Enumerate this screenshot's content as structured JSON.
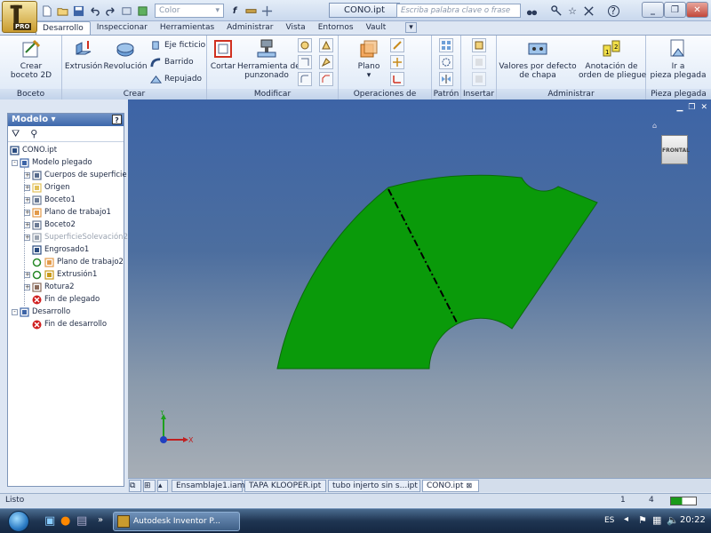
{
  "app": {
    "doc_title": "CONO.ipt",
    "search_placeholder": "Escriba palabra clave o frase",
    "badge": "PRO",
    "color_select": "Color"
  },
  "tabs": [
    "Desarrollo",
    "Inspeccionar",
    "Herramientas",
    "Administrar",
    "Vista",
    "Entornos",
    "Vault"
  ],
  "ribbon": {
    "boceto": {
      "title": "Boceto",
      "crear_boceto": "Crear\nboceto 2D"
    },
    "crear": {
      "title": "Crear",
      "extrusion": "Extrusión",
      "revolucion": "Revolución",
      "eje": "Eje ficticio",
      "barrido": "Barrido",
      "repujado": "Repujado"
    },
    "modificar": {
      "title": "Modificar",
      "cortar": "Cortar",
      "herramienta": "Herramienta de\npunzonado"
    },
    "operaciones": {
      "title": "Operaciones de trabajo",
      "plano": "Plano"
    },
    "patron": {
      "title": "Patrón"
    },
    "insertar": {
      "title": "Insertar"
    },
    "administrar": {
      "title": "Administrar",
      "valores": "Valores por defecto\nde chapa",
      "anotacion": "Anotación de\norden de pliegue"
    },
    "pieza": {
      "title": "Pieza plegada",
      "ir": "Ir a\npieza plegada"
    }
  },
  "browser": {
    "title": "Modelo",
    "nodes": [
      {
        "label": "CONO.ipt",
        "icon": "part-icon",
        "level": 0,
        "dim": false
      },
      {
        "label": "Modelo plegado",
        "icon": "folded-model-icon",
        "level": 1,
        "dim": false,
        "expander": "-"
      },
      {
        "label": "Cuerpos de superficie",
        "icon": "surface-bodies-icon",
        "level": 2,
        "dim": false,
        "expander": "+"
      },
      {
        "label": "Origen",
        "icon": "folder-icon",
        "level": 2,
        "dim": false,
        "expander": "+"
      },
      {
        "label": "Boceto1",
        "icon": "sketch-icon",
        "level": 2,
        "dim": false,
        "expander": "+"
      },
      {
        "label": "Plano de trabajo1",
        "icon": "work-plane-icon",
        "level": 2,
        "dim": false,
        "expander": "+"
      },
      {
        "label": "Boceto2",
        "icon": "sketch-icon",
        "level": 2,
        "dim": false,
        "expander": "+"
      },
      {
        "label": "SuperficieSolevación2",
        "icon": "loft-surface-icon",
        "level": 2,
        "dim": true,
        "expander": "+"
      },
      {
        "label": "Engrosado1",
        "icon": "thicken-icon",
        "level": 2,
        "dim": false,
        "expander": ""
      },
      {
        "label": "Plano de trabajo2",
        "icon": "work-plane-icon",
        "level": 2,
        "dim": false,
        "expander": "",
        "extra": "rebuild-icon"
      },
      {
        "label": "Extrusión1",
        "icon": "extrusion-icon",
        "level": 2,
        "dim": false,
        "expander": "+",
        "extra": "rebuild-icon"
      },
      {
        "label": "Rotura2",
        "icon": "rip-icon",
        "level": 2,
        "dim": false,
        "expander": "+"
      },
      {
        "label": "Fin de plegado",
        "icon": "end-of-part-icon",
        "level": 2,
        "dim": false,
        "expander": ""
      },
      {
        "label": "Desarrollo",
        "icon": "flat-pattern-icon",
        "level": 1,
        "dim": false,
        "expander": "-"
      },
      {
        "label": "Fin de desarrollo",
        "icon": "end-of-part-icon",
        "level": 2,
        "dim": false,
        "expander": ""
      }
    ]
  },
  "viewcube": {
    "face": "FRONTAL"
  },
  "triad": {
    "x": "X",
    "y": "Y"
  },
  "doc_tabs": [
    "Ensamblaje1.iam",
    "TAPA KLOOPER.ipt",
    "tubo injerto  sin s...ipt",
    "CONO.ipt"
  ],
  "status": {
    "text": "Listo",
    "n1": "1",
    "n2": "4"
  },
  "taskbar": {
    "app": "Autodesk Inventor P...",
    "lang": "ES",
    "clock": "20:22"
  },
  "colors": {
    "part": "#0a9a0a",
    "part_edge": "#0a6a0a",
    "viewport_top": "#3d64a6"
  }
}
